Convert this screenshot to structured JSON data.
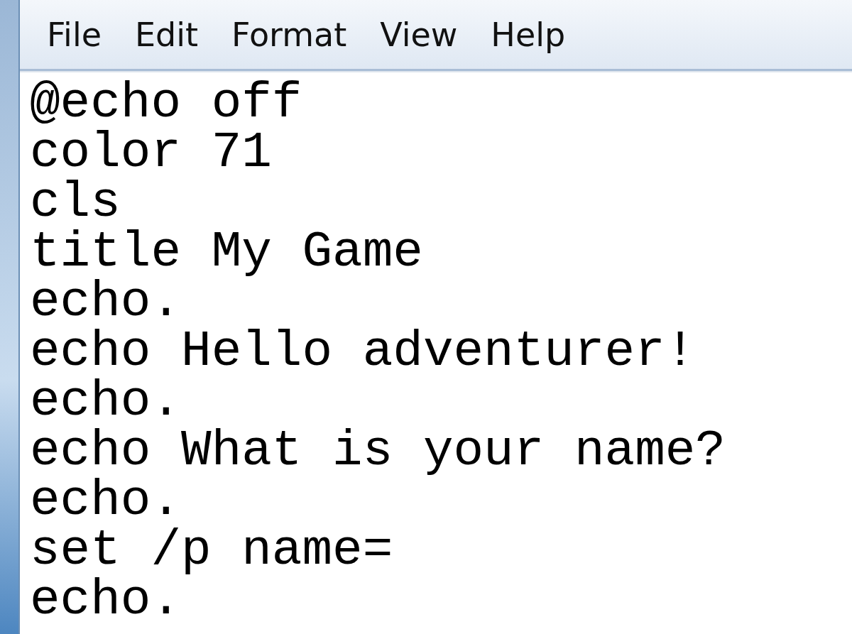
{
  "menu": [
    {
      "label": "File"
    },
    {
      "label": "Edit"
    },
    {
      "label": "Format"
    },
    {
      "label": "View"
    },
    {
      "label": "Help"
    }
  ],
  "lines": [
    "@echo off",
    "color 71",
    "cls",
    "title My Game",
    "echo.",
    "echo Hello adventurer!",
    "echo.",
    "echo What is your name?",
    "echo.",
    "set /p name=",
    "echo."
  ]
}
